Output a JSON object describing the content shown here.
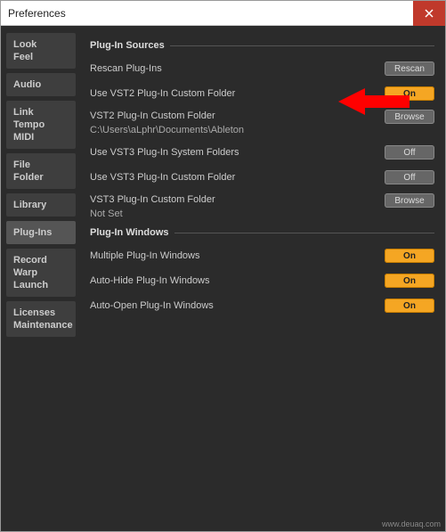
{
  "window": {
    "title": "Preferences"
  },
  "sidebar": {
    "groups": [
      {
        "lines": [
          "Look",
          "Feel"
        ]
      },
      {
        "lines": [
          "Audio"
        ]
      },
      {
        "lines": [
          "Link",
          "Tempo",
          "MIDI"
        ]
      },
      {
        "lines": [
          "File",
          "Folder"
        ]
      },
      {
        "lines": [
          "Library"
        ]
      },
      {
        "lines": [
          "Plug-Ins"
        ],
        "active": true
      },
      {
        "lines": [
          "Record",
          "Warp",
          "Launch"
        ]
      },
      {
        "lines": [
          "Licenses",
          "Maintenance"
        ]
      }
    ]
  },
  "main": {
    "section_sources": "Plug-In Sources",
    "section_windows": "Plug-In Windows",
    "rows": {
      "rescan": {
        "label": "Rescan Plug-Ins",
        "button": "Rescan"
      },
      "vst2custom": {
        "label": "Use VST2 Plug-In Custom Folder",
        "button": "On"
      },
      "vst2folder": {
        "label": "VST2 Plug-In Custom Folder",
        "path": "C:\\Users\\aLphr\\Documents\\Ableton",
        "button": "Browse"
      },
      "vst3system": {
        "label": "Use VST3 Plug-In System Folders",
        "button": "Off"
      },
      "vst3custom": {
        "label": "Use VST3 Plug-In Custom Folder",
        "button": "Off"
      },
      "vst3folder": {
        "label": "VST3 Plug-In Custom Folder",
        "path": "Not Set",
        "button": "Browse"
      },
      "multiwin": {
        "label": "Multiple Plug-In Windows",
        "button": "On"
      },
      "autohide": {
        "label": "Auto-Hide Plug-In Windows",
        "button": "On"
      },
      "autoopen": {
        "label": "Auto-Open Plug-In Windows",
        "button": "On"
      }
    }
  },
  "watermark": "www.deuaq.com"
}
